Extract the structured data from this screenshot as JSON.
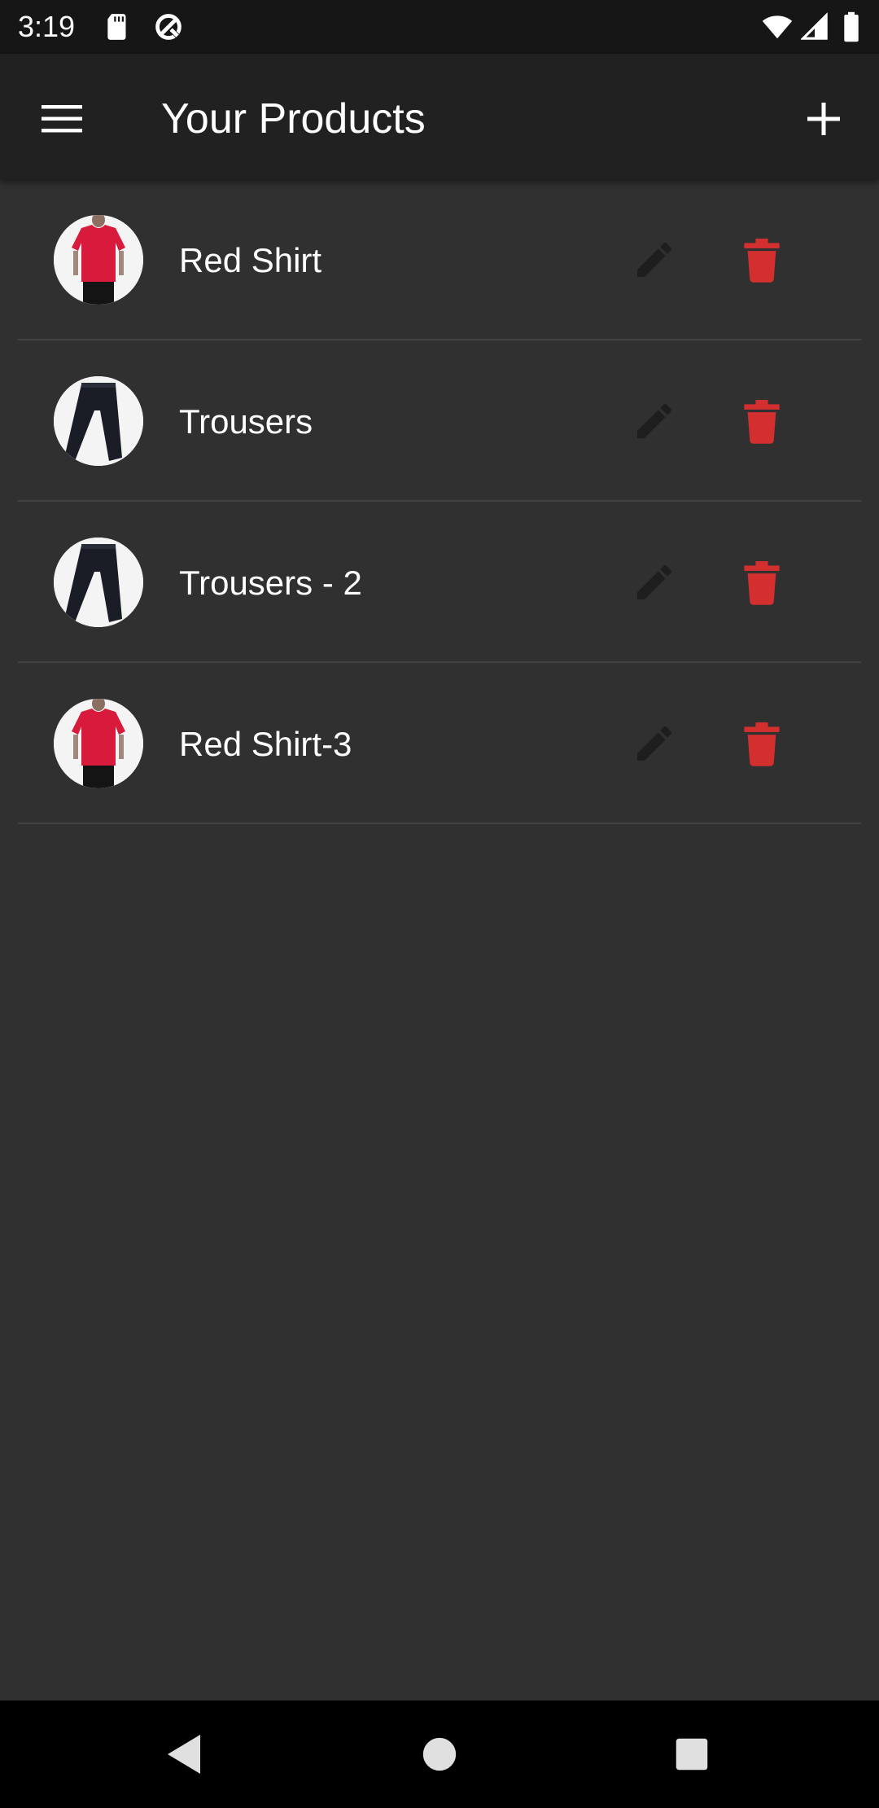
{
  "status_bar": {
    "time": "3:19",
    "left_icons": [
      "sd-card-icon",
      "data-saver-icon"
    ],
    "right_icons": [
      "wifi-icon",
      "cellular-signal-icon",
      "battery-icon"
    ]
  },
  "app_bar": {
    "title": "Your Products",
    "menu_icon": "hamburger-menu-icon",
    "add_icon": "plus-icon"
  },
  "products": [
    {
      "title": "Red Shirt",
      "image": "red-shirt"
    },
    {
      "title": "Trousers",
      "image": "trousers"
    },
    {
      "title": "Trousers - 2",
      "image": "trousers"
    },
    {
      "title": "Red Shirt-3",
      "image": "red-shirt"
    }
  ],
  "colors": {
    "background": "#303030",
    "app_bar": "#212121",
    "status_bar": "#161616",
    "edit_icon": "#1e1e1e",
    "delete_icon": "#d32f2f",
    "divider": "#424242",
    "text": "#ffffff"
  },
  "nav_bar": {
    "icons": [
      "back-icon",
      "home-icon",
      "recents-icon"
    ]
  }
}
